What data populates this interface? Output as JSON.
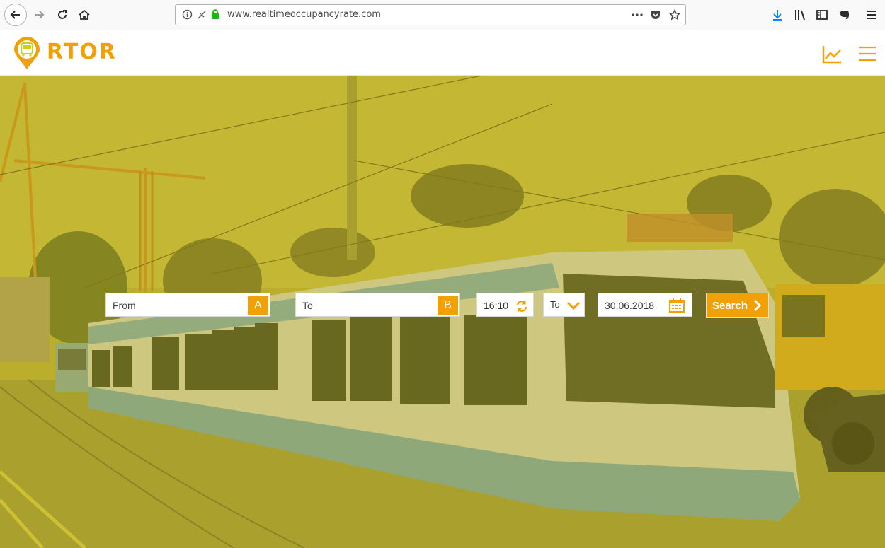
{
  "browser": {
    "url": "www.realtimeoccupancyrate.com"
  },
  "site": {
    "logo_text": "RTOR"
  },
  "search": {
    "from_placeholder": "From",
    "from_badge": "A",
    "to_placeholder": "To",
    "to_badge": "B",
    "time": "16:10",
    "direction": "To",
    "date": "30.06.2018",
    "search_label": "Search"
  },
  "colors": {
    "accent": "#f2a007",
    "overlay": "#bfae14"
  }
}
